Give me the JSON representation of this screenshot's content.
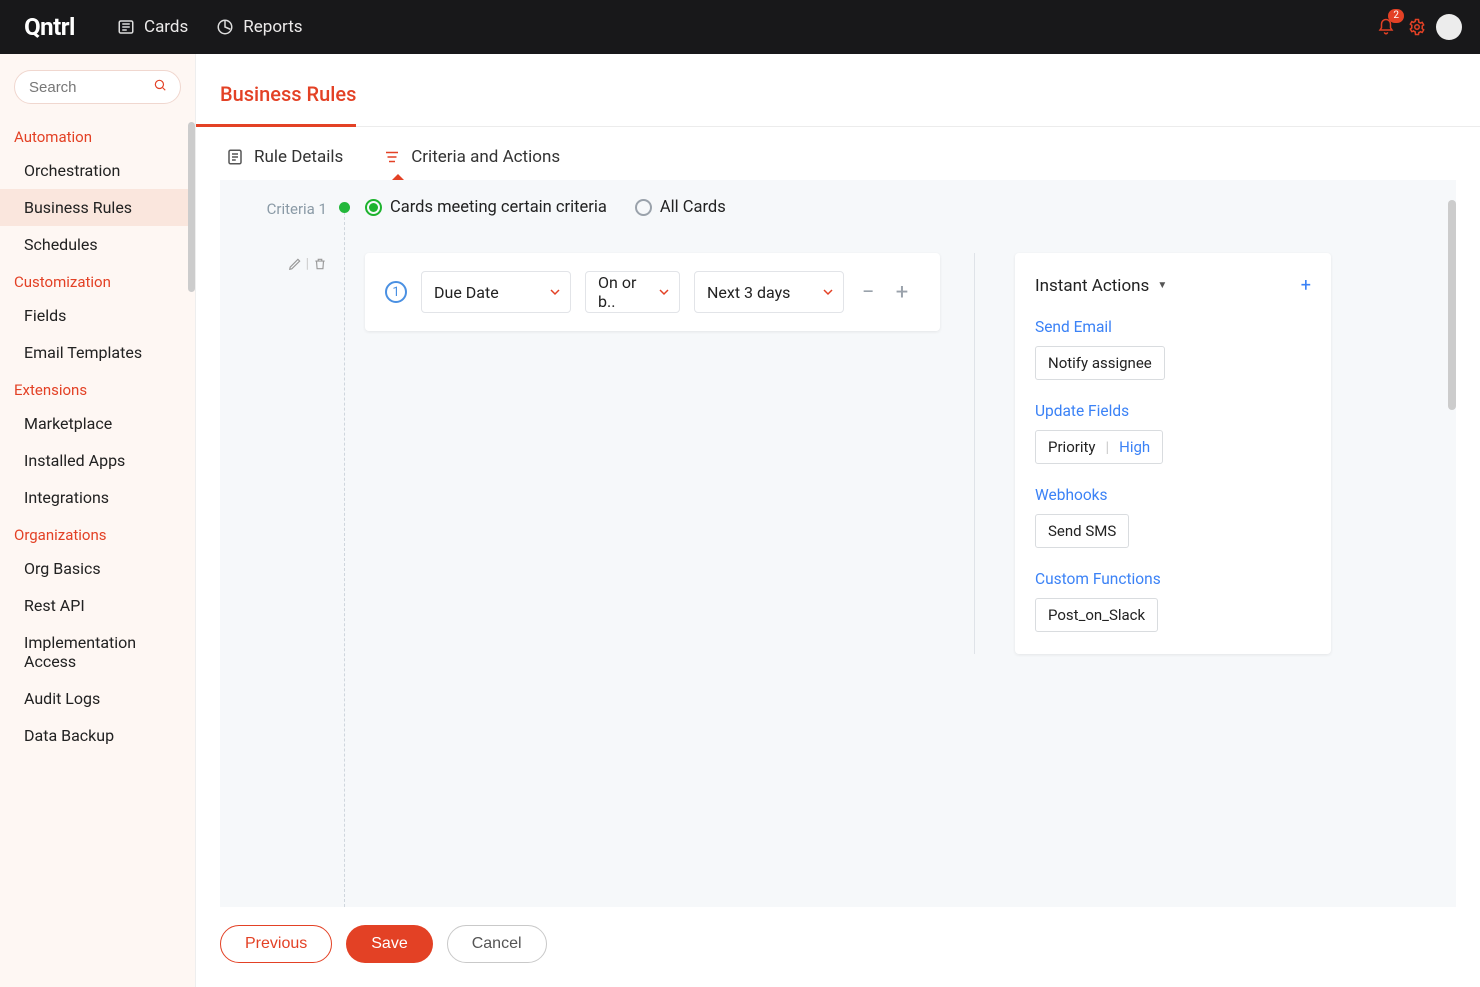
{
  "brand": "Qntrl",
  "topnav": {
    "cards": "Cards",
    "reports": "Reports"
  },
  "notifications": {
    "count": "2"
  },
  "search": {
    "placeholder": "Search"
  },
  "sidebar": {
    "sections": [
      {
        "title": "Automation",
        "items": [
          {
            "label": "Orchestration",
            "active": false
          },
          {
            "label": "Business Rules",
            "active": true
          },
          {
            "label": "Schedules",
            "active": false
          }
        ]
      },
      {
        "title": "Customization",
        "items": [
          {
            "label": "Fields",
            "active": false
          },
          {
            "label": "Email Templates",
            "active": false
          }
        ]
      },
      {
        "title": "Extensions",
        "items": [
          {
            "label": "Marketplace",
            "active": false
          },
          {
            "label": "Installed Apps",
            "active": false
          },
          {
            "label": "Integrations",
            "active": false
          }
        ]
      },
      {
        "title": "Organizations",
        "items": [
          {
            "label": "Org Basics",
            "active": false
          },
          {
            "label": "Rest API",
            "active": false
          },
          {
            "label": "Implementation Access",
            "active": false
          },
          {
            "label": "Audit Logs",
            "active": false
          },
          {
            "label": "Data Backup",
            "active": false
          }
        ]
      }
    ]
  },
  "page": {
    "title": "Business Rules"
  },
  "tabs": {
    "ruleDetails": "Rule Details",
    "criteriaActions": "Criteria and Actions"
  },
  "criteria": {
    "label": "Criteria 1",
    "radios": {
      "specific": "Cards meeting certain criteria",
      "all": "All Cards"
    },
    "step": "1",
    "field": "Due Date",
    "operator": "On or b..",
    "value": "Next 3 days"
  },
  "actions": {
    "title": "Instant Actions",
    "sendEmail": {
      "heading": "Send Email",
      "chip": "Notify assignee"
    },
    "updateFields": {
      "heading": "Update Fields",
      "field": "Priority",
      "value": "High"
    },
    "webhooks": {
      "heading": "Webhooks",
      "chip": "Send SMS"
    },
    "customFunctions": {
      "heading": "Custom Functions",
      "chip": "Post_on_Slack"
    }
  },
  "footer": {
    "previous": "Previous",
    "save": "Save",
    "cancel": "Cancel"
  }
}
